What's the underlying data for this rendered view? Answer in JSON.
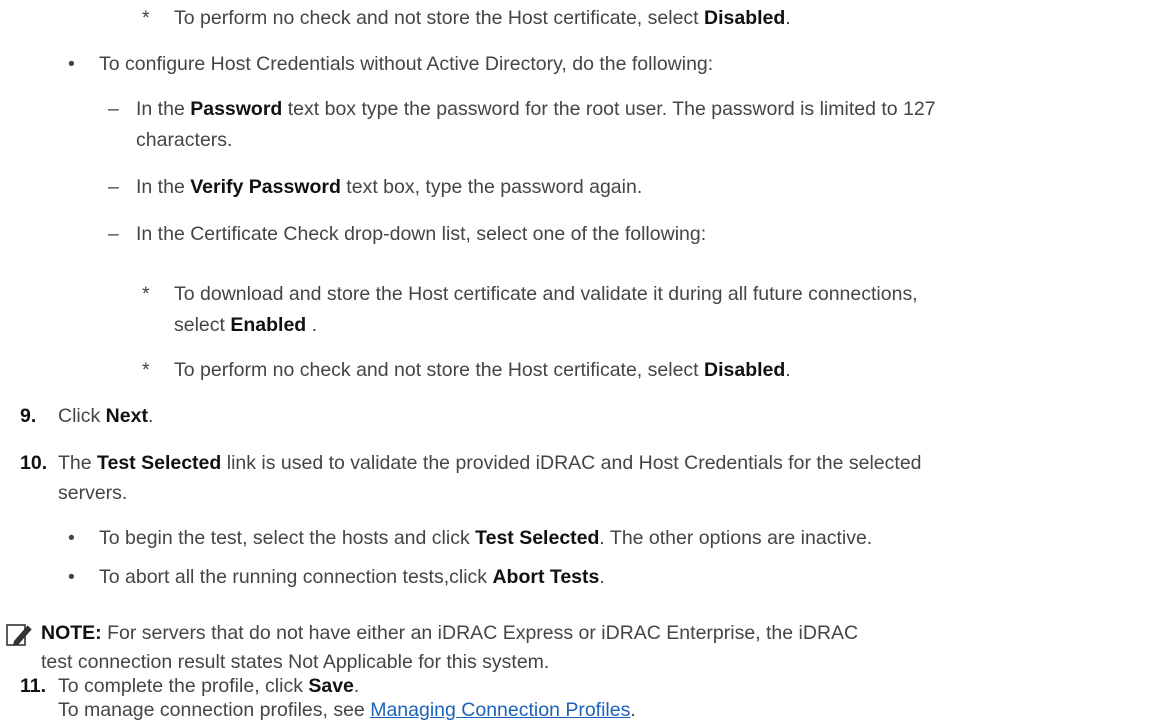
{
  "top_item": {
    "marker": "*",
    "pre": "To perform no check and not store the Host certificate, select ",
    "bold": "Disabled",
    "post": "."
  },
  "host_no_ad": {
    "marker": "•",
    "text": "To configure Host Credentials without Active Directory, do the following:"
  },
  "password_item": {
    "marker": "–",
    "pre": "In the ",
    "bold": "Password",
    "post": " text box type the password for the root user. The password is limited to 127",
    "cont": "characters."
  },
  "verify_item": {
    "marker": "–",
    "pre": "In the ",
    "bold": "Verify Password",
    "post": " text box, type the password again."
  },
  "cert_item": {
    "marker": "–",
    "text": "In the Certificate Check drop-down list, select one of the following:"
  },
  "cert_enabled": {
    "marker": "*",
    "text": "To download and store the Host certificate and validate it during all future connections,",
    "pre2": "select ",
    "bold": "Enabled",
    "post": " ."
  },
  "cert_disabled": {
    "marker": "*",
    "pre": "To perform no check and not store the Host certificate, select ",
    "bold": "Disabled",
    "post": "."
  },
  "step9": {
    "num": "9.",
    "pre": "Click ",
    "bold": "Next",
    "post": "."
  },
  "step10": {
    "num": "10.",
    "pre": "The ",
    "bold": "Test Selected",
    "post": " link is used to validate the provided iDRAC and Host Credentials for the selected",
    "cont": "servers."
  },
  "test_begin": {
    "marker": "•",
    "pre": "To begin the test, select the hosts and click ",
    "bold": "Test Selected",
    "post": ". The other options are inactive."
  },
  "test_abort": {
    "marker": "•",
    "pre": "To abort all the running connection tests,click ",
    "bold": "Abort Tests",
    "post": "."
  },
  "note": {
    "label": "NOTE:",
    "text1": " For servers that do not have either an iDRAC Express or iDRAC Enterprise, the iDRAC",
    "text2": "test connection result states Not Applicable for this system."
  },
  "step11": {
    "num": "11.",
    "pre": "To complete the profile, click ",
    "bold": "Save",
    "post": ".",
    "sub_pre": "To manage connection profiles, see ",
    "link": "Managing Connection Profiles",
    "sub_post": "."
  }
}
